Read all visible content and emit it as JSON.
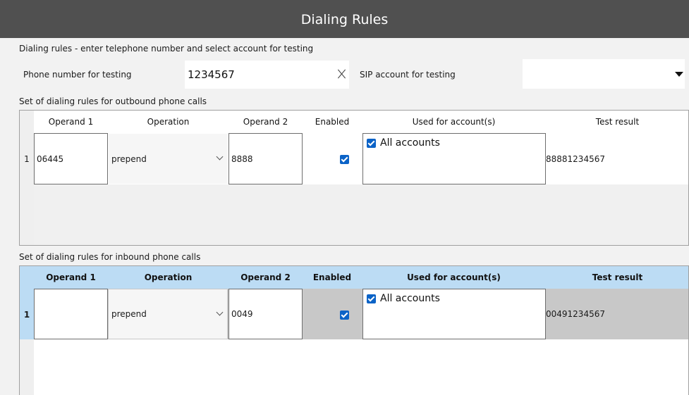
{
  "window": {
    "title": "Dialing Rules"
  },
  "testing": {
    "section_label": "Dialing rules - enter telephone number and select account for testing",
    "phone_label": "Phone number for testing",
    "phone_value": "1234567",
    "sip_label": "SIP account for testing",
    "sip_value": ""
  },
  "outbound": {
    "section_label": "Set of dialing rules for outbound phone calls",
    "columns": [
      "Operand 1",
      "Operation",
      "Operand 2",
      "Enabled",
      "Used for account(s)",
      "Test result"
    ],
    "rows": [
      {
        "num": "1",
        "operand1": "06445",
        "operation": "prepend",
        "operand2": "8888",
        "enabled": true,
        "account": "All accounts",
        "account_checked": true,
        "result": "88881234567"
      }
    ]
  },
  "inbound": {
    "section_label": "Set of dialing rules for inbound phone calls",
    "columns": [
      "Operand 1",
      "Operation",
      "Operand 2",
      "Enabled",
      "Used for account(s)",
      "Test result"
    ],
    "rows": [
      {
        "num": "1",
        "operand1": "",
        "operation": "prepend",
        "operand2": "0049",
        "enabled": true,
        "account": "All accounts",
        "account_checked": true,
        "result": "00491234567"
      }
    ]
  },
  "colors": {
    "titlebar": "#505050",
    "header_selected": "#bcdcf4",
    "row_selected": "#c8c8c8",
    "checkbox": "#0b63c7"
  },
  "icons": {
    "clear": "close-x-icon",
    "dropdown": "caret-down-icon",
    "combo": "chevron-down-icon",
    "check": "checkbox-checked-icon"
  }
}
